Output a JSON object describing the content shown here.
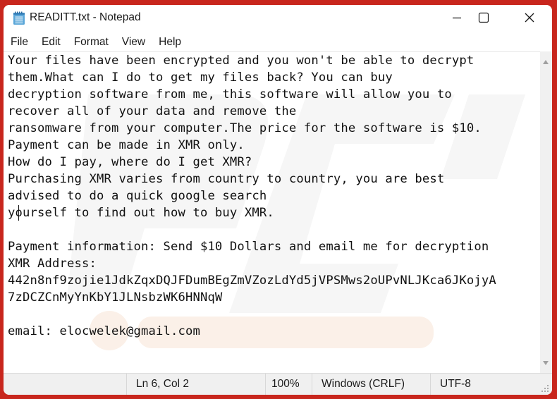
{
  "window": {
    "title": "READITT.txt - Notepad",
    "app_icon": "notepad-icon",
    "controls": {
      "minimize": "minimize-icon",
      "maximize": "maximize-icon",
      "close": "close-icon"
    }
  },
  "menu": {
    "items": [
      {
        "label": "File"
      },
      {
        "label": "Edit"
      },
      {
        "label": "Format"
      },
      {
        "label": "View"
      },
      {
        "label": "Help"
      }
    ]
  },
  "editor": {
    "lines": [
      "Your files have been encrypted and you won't be able to decrypt",
      "them.What can I do to get my files back? You can buy",
      "decryption software from me, this software will allow you to",
      "recover all of your data and remove the",
      "ransomware from your computer.The price for the software is $10.",
      "Payment can be made in XMR only.",
      "How do I pay, where do I get XMR?",
      "Purchasing XMR varies from country to country, you are best",
      "advised to do a quick google search",
      "yourself to find out how to buy XMR.",
      "",
      "Payment information: Send $10 Dollars and email me for decryption",
      "XMR Address:",
      "442n8nf9zojie1JdkZqxDQJFDumBEgZmVZozLdYd5jVPSMws2oUPvNLJKca6JKojyA",
      "7zDCZCnMyYnKbY1JLNsbzWK6HNNqW",
      "",
      "email: elocwelek@gmail.com"
    ]
  },
  "status_bar": {
    "position": "Ln 6, Col 2",
    "zoom": "100%",
    "line_ending": "Windows (CRLF)",
    "encoding": "UTF-8"
  },
  "colors": {
    "background": "#c8261d",
    "statusbar": "#f0f0f0",
    "text": "#111111"
  }
}
